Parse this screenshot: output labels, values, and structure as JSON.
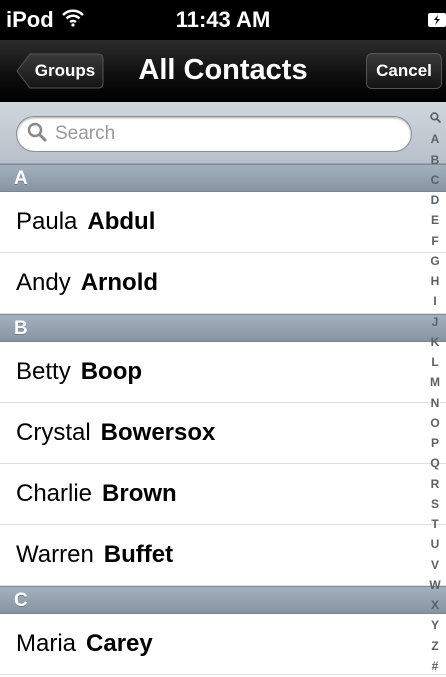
{
  "status_bar": {
    "carrier": "iPod",
    "time": "11:43 AM"
  },
  "nav": {
    "back_label": "Groups",
    "title": "All Contacts",
    "cancel_label": "Cancel"
  },
  "search": {
    "placeholder": "Search"
  },
  "sections": [
    {
      "letter": "A",
      "contacts": [
        {
          "first": "Paula",
          "last": "Abdul"
        },
        {
          "first": "Andy",
          "last": "Arnold"
        }
      ]
    },
    {
      "letter": "B",
      "contacts": [
        {
          "first": "Betty",
          "last": "Boop"
        },
        {
          "first": "Crystal",
          "last": "Bowersox"
        },
        {
          "first": "Charlie",
          "last": "Brown"
        },
        {
          "first": "Warren",
          "last": "Buffet"
        }
      ]
    },
    {
      "letter": "C",
      "contacts": [
        {
          "first": "Maria",
          "last": "Carey"
        }
      ]
    }
  ],
  "index_letters": [
    "A",
    "B",
    "C",
    "D",
    "E",
    "F",
    "G",
    "H",
    "I",
    "J",
    "K",
    "L",
    "M",
    "N",
    "O",
    "P",
    "Q",
    "R",
    "S",
    "T",
    "U",
    "V",
    "W",
    "X",
    "Y",
    "Z",
    "#"
  ],
  "icons": {
    "wifi": "wifi-icon",
    "battery": "battery-icon",
    "search": "search-icon"
  },
  "colors": {
    "nav_bar": "#000000",
    "section_header": "#8a97a5",
    "index_text": "#5b6168"
  }
}
